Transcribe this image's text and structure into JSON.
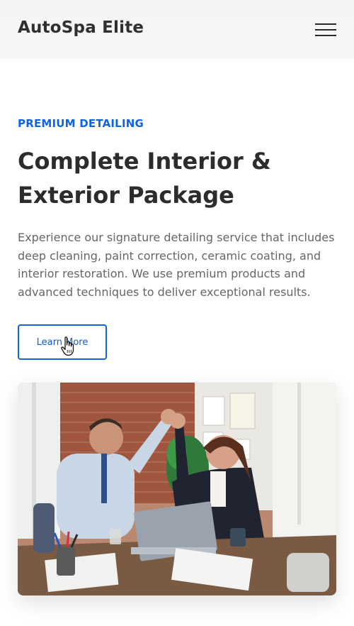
{
  "header": {
    "brand": "AutoSpa Elite",
    "menu_icon": "hamburger-menu-icon"
  },
  "hero": {
    "eyebrow": "PREMIUM DETAILING",
    "title": "Complete Interior & Exterior Package",
    "description": "Experience our signature detailing service that includes deep cleaning, paint correction, ceramic coating, and interior restoration. We use premium products and advanced techniques to deliver exceptional results.",
    "cta_label": "Learn More"
  },
  "colors": {
    "accent": "#0f63e6",
    "heading": "#2c2c2c",
    "body_text": "#666666"
  },
  "image": {
    "subject": "two-colleagues-high-five-photo"
  }
}
